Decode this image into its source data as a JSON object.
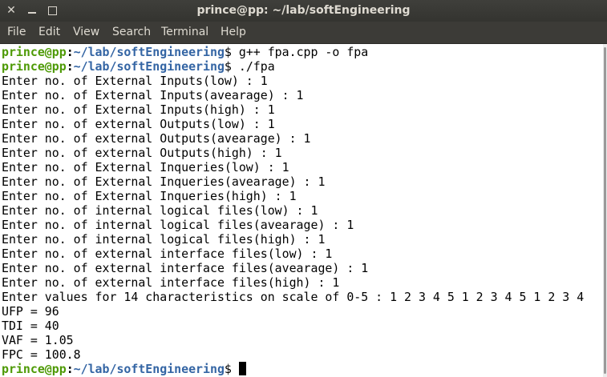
{
  "window": {
    "title": "prince@pp: ~/lab/softEngineering",
    "close_glyph": "✕"
  },
  "menu": [
    "File",
    "Edit",
    "View",
    "Search",
    "Terminal",
    "Help"
  ],
  "prompt": {
    "user_host": "prince@pp",
    "colon": ":",
    "path": "~/lab/softEngineering",
    "dollar": "$"
  },
  "commands": [
    " g++ fpa.cpp -o fpa",
    " ./fpa"
  ],
  "output": [
    "Enter no. of External Inputs(low) : 1",
    "Enter no. of External Inputs(avearage) : 1",
    "Enter no. of External Inputs(high) : 1",
    "Enter no. of external Outputs(low) : 1",
    "Enter no. of external Outputs(avearage) : 1",
    "Enter no. of external Outputs(high) : 1",
    "Enter no. of External Inqueries(low) : 1",
    "Enter no. of External Inqueries(avearage) : 1",
    "Enter no. of External Inqueries(high) : 1",
    "Enter no. of internal logical files(low) : 1",
    "Enter no. of internal logical files(avearage) : 1",
    "Enter no. of internal logical files(high) : 1",
    "Enter no. of external interface files(low) : 1",
    "Enter no. of external interface files(avearage) : 1",
    "Enter no. of external interface files(high) : 1",
    "Enter values for 14 characteristics on scale of 0-5 : 1 2 3 4 5 1 2 3 4 5 1 2 3 4",
    "UFP = 96",
    "TDI = 40",
    "VAF = 1.05",
    "FPC = 100.8"
  ],
  "colors": {
    "prompt_user": "#4e9a06",
    "prompt_path": "#3465a4",
    "titlebar": "#3c3b37"
  },
  "icons": [
    "close-icon",
    "minimize-icon",
    "maximize-icon"
  ]
}
